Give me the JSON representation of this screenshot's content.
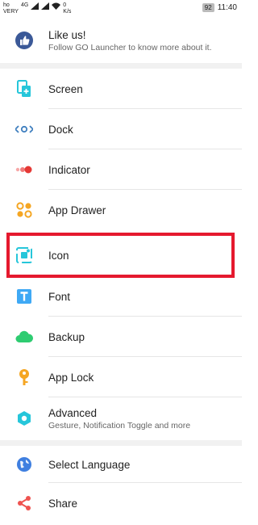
{
  "status_bar": {
    "carrier_top": "ho",
    "carrier_bottom": "VERY",
    "network": "4G",
    "speed_value": "0",
    "speed_unit": "K/s",
    "battery": "92",
    "time": "11:40"
  },
  "like": {
    "title": "Like us!",
    "subtitle": "Follow GO Launcher to know more about it.",
    "icon": "thumbs-up-icon"
  },
  "menu": [
    {
      "label": "Screen",
      "icon": "screen-icon"
    },
    {
      "label": "Dock",
      "icon": "dock-icon"
    },
    {
      "label": "Indicator",
      "icon": "indicator-icon"
    },
    {
      "label": "App Drawer",
      "icon": "app-drawer-icon"
    },
    {
      "label": "Icon",
      "icon": "icon-settings-icon"
    },
    {
      "label": "Font",
      "icon": "font-icon"
    },
    {
      "label": "Backup",
      "icon": "cloud-backup-icon"
    },
    {
      "label": "App Lock",
      "icon": "key-icon"
    },
    {
      "label": "Advanced",
      "subtitle": "Gesture, Notification Toggle and more",
      "icon": "advanced-icon"
    }
  ],
  "menu2": [
    {
      "label": "Select Language",
      "icon": "globe-icon"
    },
    {
      "label": "Share",
      "icon": "share-icon"
    }
  ],
  "colors": {
    "highlight": "#e5192e",
    "facebook_blue": "#3b5998",
    "teal": "#26c6da",
    "orange": "#f5a623",
    "red_dots": "#ef5350",
    "green": "#2ecc71"
  }
}
